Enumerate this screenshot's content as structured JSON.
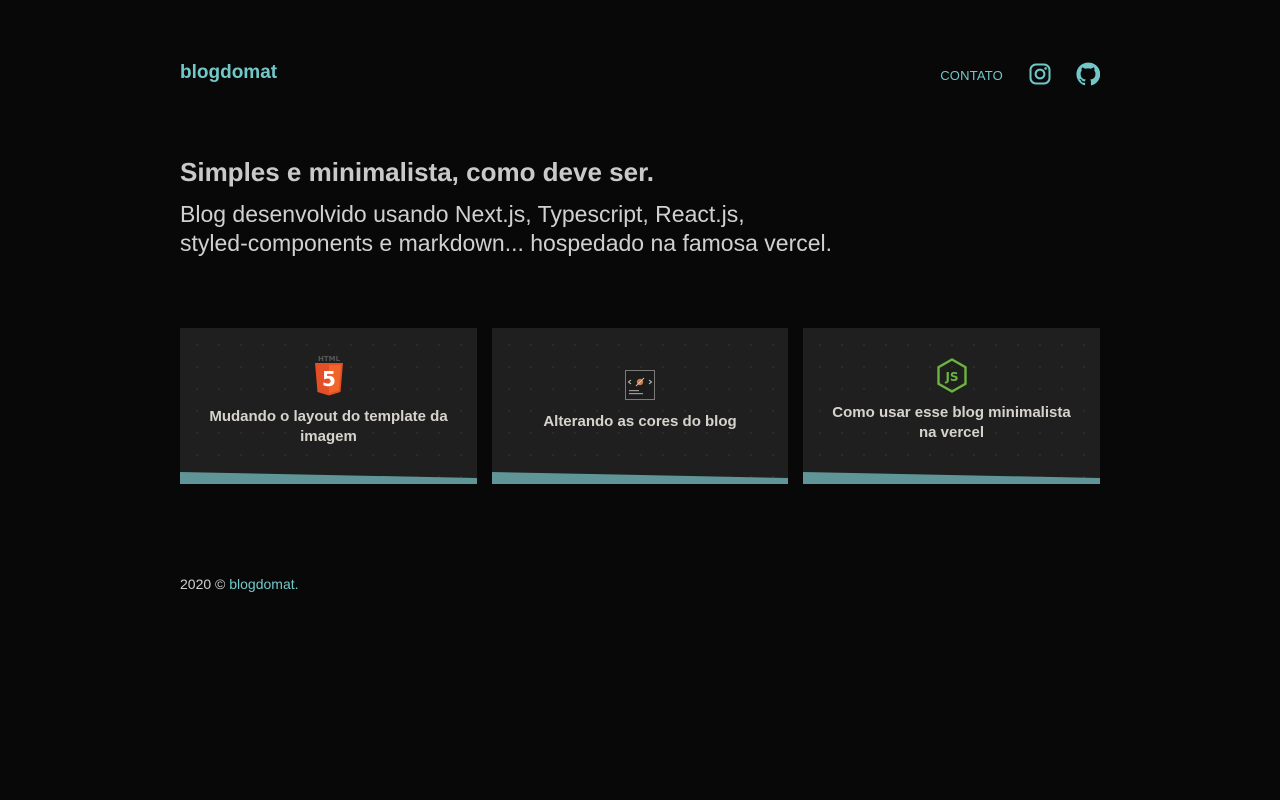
{
  "header": {
    "logo": "blogdomat",
    "nav": {
      "contact_label": "CONTATO"
    },
    "social_icons": [
      "instagram-icon",
      "github-icon"
    ]
  },
  "hero": {
    "title": "Simples e minimalista, como deve ser.",
    "description_line1": "Blog desenvolvido usando Next.js, Typescript, React.js,",
    "description_line2": "styled-components e markdown... hospedado na famosa vercel."
  },
  "posts": [
    {
      "title_line1": "Mudando o layout do template da",
      "title_line2": "imagem",
      "icon": "html5-icon",
      "icon_text": "HTML",
      "icon_glyph": "5"
    },
    {
      "title_line1": "Alterando as cores do blog",
      "title_line2": "",
      "icon": "styled-components-icon"
    },
    {
      "title_line1": "Como usar esse blog minimalista",
      "title_line2": "na vercel",
      "icon": "nodejs-icon",
      "icon_glyph": "JS"
    }
  ],
  "footer": {
    "year_text": "2020 ©",
    "brand": "blogdomat."
  },
  "colors": {
    "accent": "#72c7c9",
    "background": "#080808",
    "card_bg": "#1f1f1f",
    "card_stripe": "#5f9596"
  }
}
